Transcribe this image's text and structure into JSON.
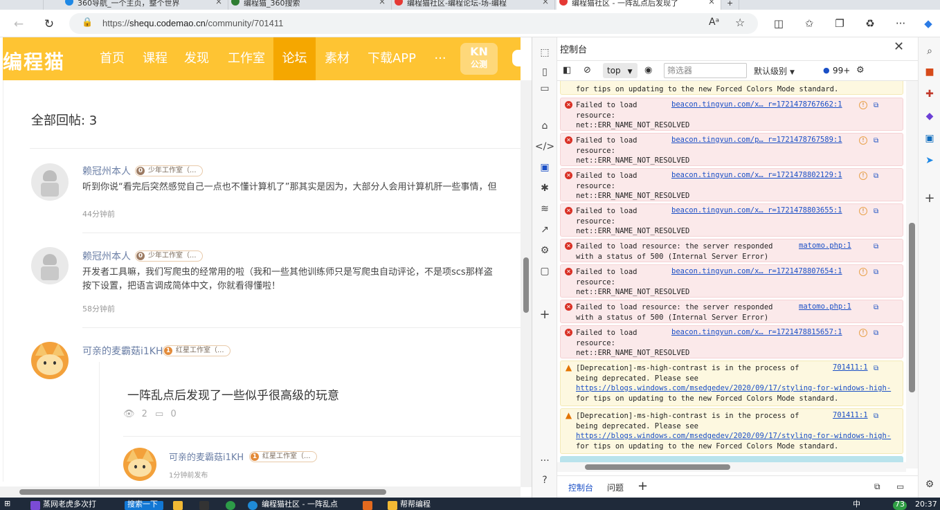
{
  "browser": {
    "tabs": [
      {
        "label": "360导航_一个主页，整个世界",
        "icon_color": "#1e88e5"
      },
      {
        "label": "编程猫_360搜索",
        "icon_color": "#2e7d32"
      },
      {
        "label": "编程猫社区-编程论坛-场-编程",
        "icon_color": "#e53935"
      },
      {
        "label": "编程猫社区 - 一阵乱点后发现了",
        "icon_color": "#e53935"
      }
    ],
    "url_scheme": "https://",
    "url_host": "shequ.codemao.cn",
    "url_path": "/community/701411",
    "icons": {
      "back": "back-arrow-icon",
      "refresh": "refresh-icon",
      "lock": "lock-icon",
      "read_aloud": "read-aloud-icon",
      "favorite": "star-icon",
      "split": "split-screen-icon",
      "favorites": "favorites-icon",
      "collections": "collections-icon",
      "extensions": "extensions-icon",
      "menu": "more-icon",
      "copilot": "copilot-icon"
    }
  },
  "site": {
    "logo": "编程猫",
    "nav": [
      "首页",
      "课程",
      "发现",
      "工作室",
      "论坛",
      "素材",
      "下载APP",
      "···"
    ],
    "active_nav": "论坛",
    "kn_top": "KN",
    "kn_bottom": "公测",
    "colors": {
      "brand": "#fec433",
      "active": "#f5a700",
      "username": "#6b7fa6"
    }
  },
  "replies": {
    "header": "全部回帖: 3",
    "items": [
      {
        "user": "赖冠州本人",
        "level": "0",
        "badge": "少年工作室（...",
        "lines": [
          "听到你说“看完后突然感觉自己一点也不懂计算机了”那其实是因为，大部分人会用计算机肝一些事情，但"
        ],
        "time": "44分钟前"
      },
      {
        "user": "赖冠州本人",
        "level": "0",
        "badge": "少年工作室（...",
        "lines": [
          "开发者工具嘛，我们写爬虫的经常用的啦（我和一些其他训练师只是写爬虫自动评论，不是项scs那样盗",
          "按下设置，把语言调成简体中文，你就看得懂啦！"
        ],
        "time": "58分钟前"
      },
      {
        "user": "可亲的麦霸菇i1KH",
        "level": "1",
        "badge": "红星工作室（...",
        "quote_title": "一阵乱点后发现了一些似乎很高级的玩意",
        "views": "2",
        "comments": "0",
        "nested_user": "可亲的麦霸菇i1KH",
        "nested_level": "1",
        "nested_badge": "红星工作室（...",
        "nested_time": "1分钟前发布"
      }
    ]
  },
  "devtools": {
    "title": "控制台",
    "context": "top",
    "filter_placeholder": "筛选器",
    "levels": "默认级别",
    "message_count": "99+",
    "drawer_tabs": [
      "控制台",
      "问题"
    ],
    "messages": [
      {
        "kind": "warn-tail",
        "line1": "for tips on updating to the new Forced Colors Mode standard."
      },
      {
        "kind": "err",
        "text": "Failed to load\nresource:\nnet::ERR_NAME_NOT_RESOLVED",
        "link": "beacon.tingyun.com/x… r=1721478767662:1"
      },
      {
        "kind": "err",
        "text": "Failed to load\nresource:\nnet::ERR_NAME_NOT_RESOLVED",
        "link": "beacon.tingyun.com/p… r=1721478767589:1"
      },
      {
        "kind": "err",
        "text": "Failed to load\nresource:\nnet::ERR_NAME_NOT_RESOLVED",
        "link": "beacon.tingyun.com/x… r=1721478802129:1"
      },
      {
        "kind": "err",
        "text": "Failed to load\nresource:\nnet::ERR_NAME_NOT_RESOLVED",
        "link": "beacon.tingyun.com/x… r=1721478803655:1"
      },
      {
        "kind": "err",
        "text": "Failed to load resource: the server responded\nwith a status of 500 (Internal Server Error)",
        "link": "matomo.php:1"
      },
      {
        "kind": "err",
        "text": "Failed to load\nresource:\nnet::ERR_NAME_NOT_RESOLVED",
        "link": "beacon.tingyun.com/x… r=1721478807654:1"
      },
      {
        "kind": "err",
        "text": "Failed to load resource: the server responded\nwith a status of 500 (Internal Server Error)",
        "link": "matomo.php:1"
      },
      {
        "kind": "err",
        "text": "Failed to load\nresource:\nnet::ERR_NAME_NOT_RESOLVED",
        "link": "beacon.tingyun.com/x… r=1721478815657:1"
      },
      {
        "kind": "warn",
        "text": "[Deprecation]-ms-high-contrast is in the process of\nbeing deprecated. Please see",
        "link": "701411:1",
        "url": "https://blogs.windows.com/msedgedev/2020/09/17/styling-for-windows-high-",
        "tail": "for tips on updating to the new Forced Colors Mode standard."
      },
      {
        "kind": "warn",
        "text": "[Deprecation]-ms-high-contrast is in the process of\nbeing deprecated. Please see",
        "link": "701411:1",
        "url": "https://blogs.windows.com/msedgedev/2020/09/17/styling-for-windows-high-",
        "tail": "for tips on updating to the new Forced Colors Mode standard."
      }
    ]
  },
  "taskbar": {
    "items": [
      "蒸网老虎多次打",
      "搜索一下",
      "编程猫社区 - 一阵乱点",
      "帮帮编程"
    ],
    "temp": "73",
    "ime": "中",
    "time": "20:37"
  }
}
